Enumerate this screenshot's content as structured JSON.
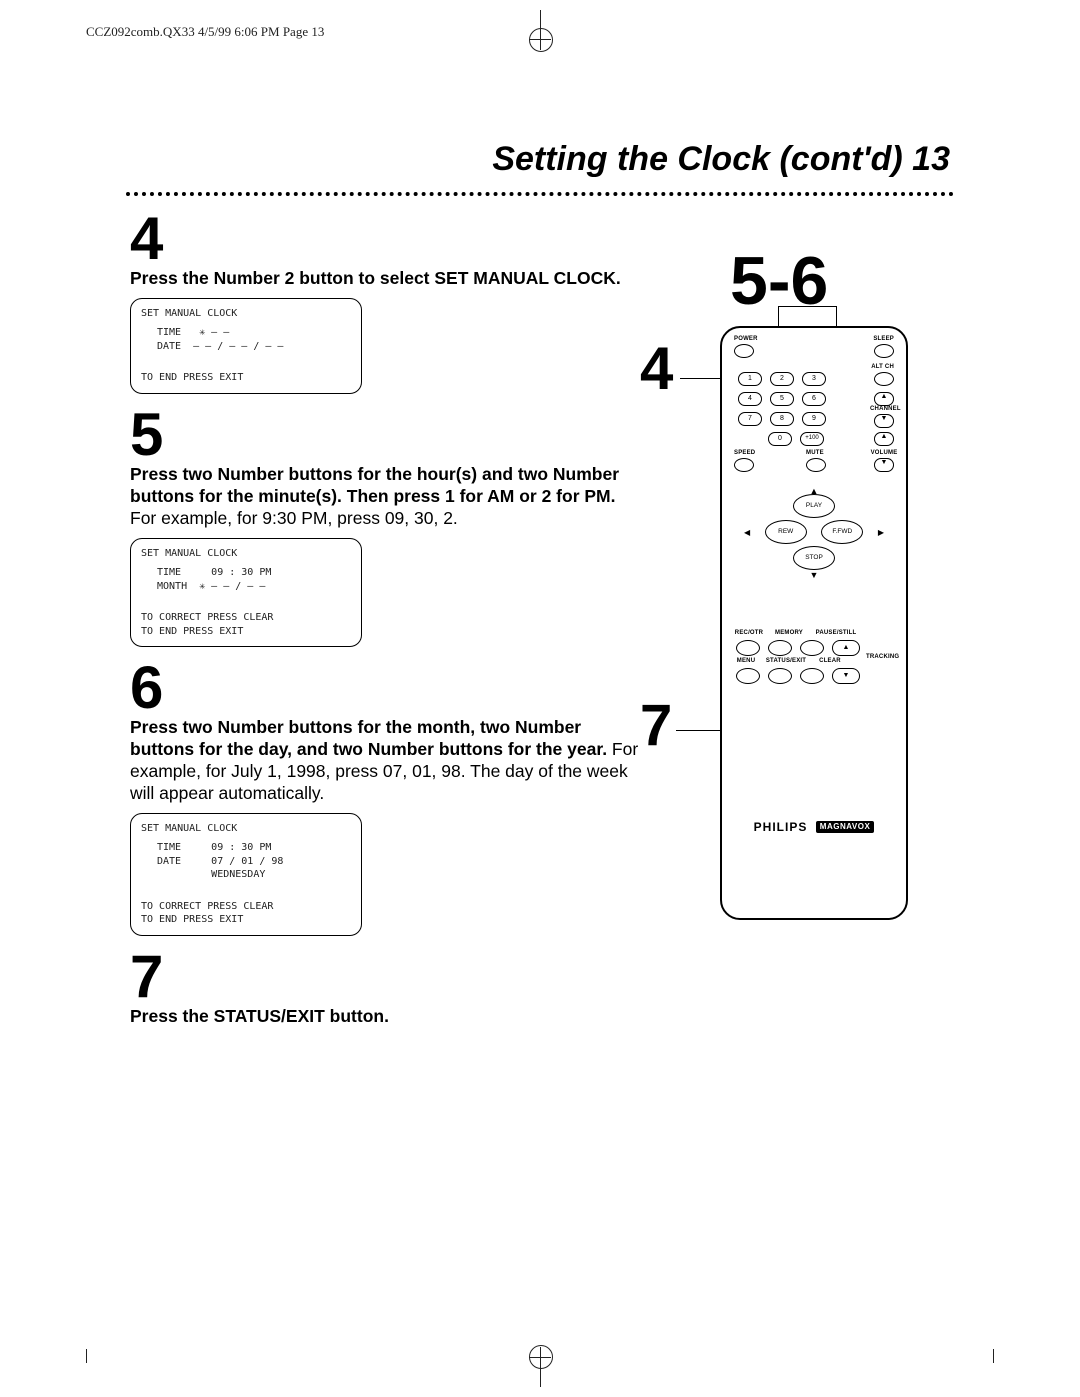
{
  "header": {
    "runhead": "CCZ092comb.QX33  4/5/99 6:06 PM  Page 13"
  },
  "title": "Setting the Clock (cont'd)  13",
  "steps": [
    {
      "num": "4",
      "bold": "Press the Number 2 button to select SET MANUAL CLOCK.",
      "plain": "",
      "lcd": {
        "title": "SET MANUAL CLOCK",
        "lines": [
          "TIME   ✳ – –",
          "DATE  – – / – – / – –"
        ],
        "foot": "TO END PRESS EXIT"
      }
    },
    {
      "num": "5",
      "bold": "Press two Number buttons for the hour(s) and two Number buttons for the minute(s). Then press 1 for AM or 2 for PM.",
      "plain": " For example, for 9:30 PM, press 09, 30, 2.",
      "lcd": {
        "title": "SET MANUAL CLOCK",
        "lines": [
          "TIME     09 : 30 PM",
          "MONTH  ✳ – – / – –"
        ],
        "foot": "TO CORRECT PRESS CLEAR\nTO END PRESS EXIT"
      }
    },
    {
      "num": "6",
      "bold": "Press two Number buttons for the month, two Number buttons for the day, and two Number buttons for the year.",
      "plain": " For example, for July 1, 1998, press 07, 01, 98. The day of the week will appear automatically.",
      "lcd": {
        "title": "SET MANUAL CLOCK",
        "lines": [
          "TIME     09 : 30 PM",
          "DATE     07 / 01 / 98",
          "         WEDNESDAY"
        ],
        "foot": "TO CORRECT PRESS CLEAR\nTO END PRESS EXIT"
      }
    },
    {
      "num": "7",
      "bold": "Press the STATUS/EXIT button.",
      "plain": "",
      "lcd": null
    }
  ],
  "callouts": {
    "c4": "4",
    "c56": "5-6",
    "c7": "7"
  },
  "remote": {
    "brand1": "PHILIPS",
    "brand2": "MAGNAVOX",
    "labels": {
      "power": "POWER",
      "sleep": "SLEEP",
      "altch": "ALT CH",
      "channel": "CHANNEL",
      "speed": "SPEED",
      "mute": "MUTE",
      "volume": "VOLUME",
      "play": "PLAY",
      "rew": "REW",
      "ffwd": "F.FWD",
      "stop": "STOP",
      "recotr": "REC/OTR",
      "memory": "MEMORY",
      "pausestill": "PAUSE/STILL",
      "menu": "MENU",
      "statusexit": "STATUS/EXIT",
      "clear": "CLEAR",
      "tracking": "TRACKING",
      "plus100": "+100"
    },
    "numbers": [
      "1",
      "2",
      "3",
      "4",
      "5",
      "6",
      "7",
      "8",
      "9",
      "0"
    ]
  }
}
